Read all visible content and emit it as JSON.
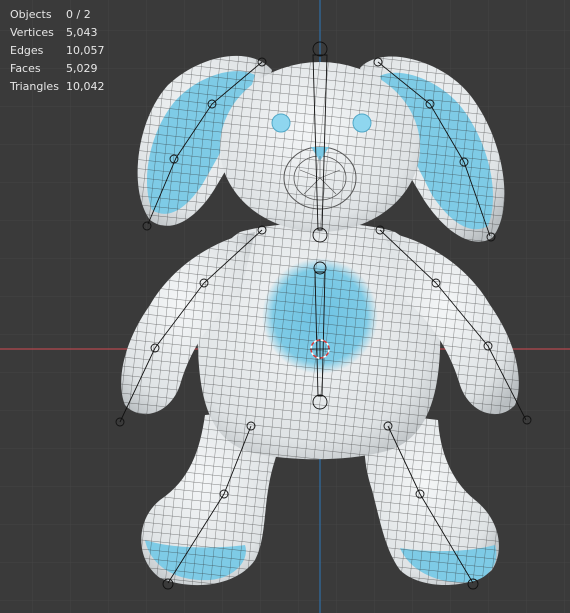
{
  "stats": [
    {
      "label": "Objects",
      "value": "0 / 2"
    },
    {
      "label": "Vertices",
      "value": "5,043"
    },
    {
      "label": "Edges",
      "value": "10,057"
    },
    {
      "label": "Faces",
      "value": "5,029"
    },
    {
      "label": "Triangles",
      "value": "10,042"
    }
  ],
  "colors": {
    "background": "#3a3a3a",
    "grid": "#454545",
    "x_axis": "#b3474d",
    "y_axis": "#2f6ea6",
    "body": "#e9edef",
    "accent_blue": "#79c8e4",
    "wire": "#222222"
  }
}
